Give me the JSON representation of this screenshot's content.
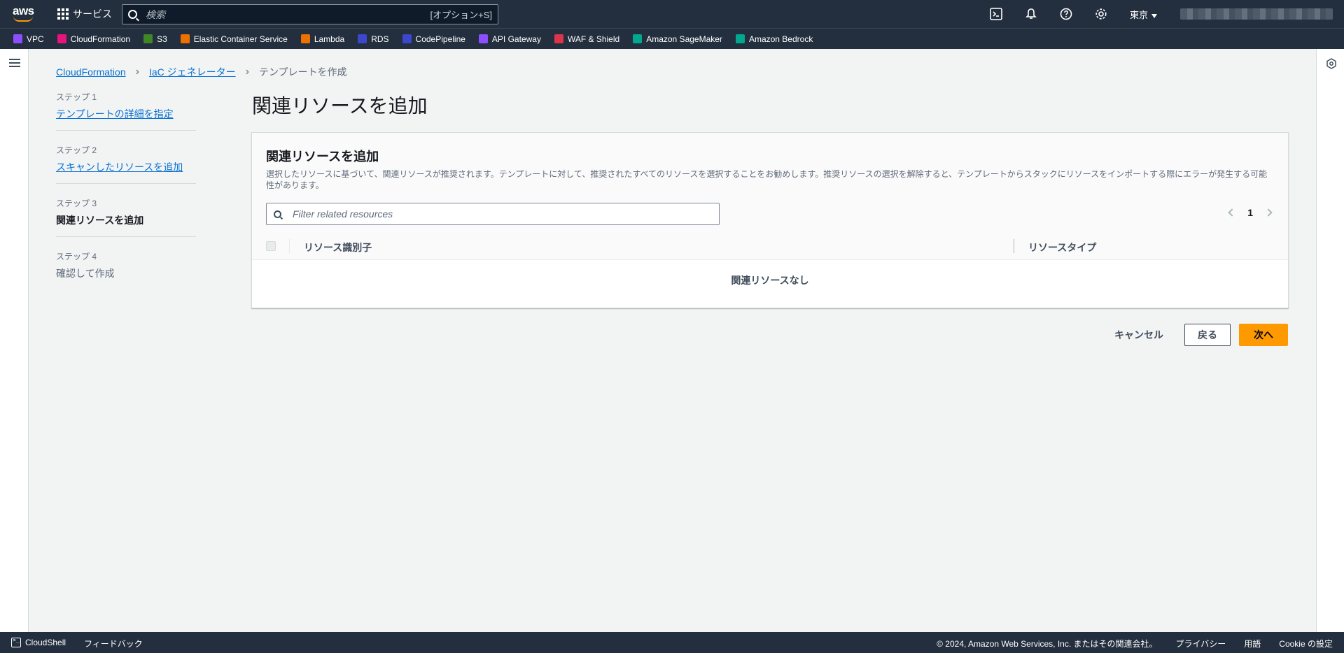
{
  "topbar": {
    "logo_text": "aws",
    "services_label": "サービス",
    "search_placeholder": "検索",
    "search_shortcut": "[オプション+S]",
    "region_label": "東京"
  },
  "favorites": [
    {
      "label": "VPC",
      "color": "#8c4fff"
    },
    {
      "label": "CloudFormation",
      "color": "#e7157b"
    },
    {
      "label": "S3",
      "color": "#3f8624"
    },
    {
      "label": "Elastic Container Service",
      "color": "#ed7100"
    },
    {
      "label": "Lambda",
      "color": "#ed7100"
    },
    {
      "label": "RDS",
      "color": "#3b48cc"
    },
    {
      "label": "CodePipeline",
      "color": "#3b48cc"
    },
    {
      "label": "API Gateway",
      "color": "#8c4fff"
    },
    {
      "label": "WAF & Shield",
      "color": "#dd344c"
    },
    {
      "label": "Amazon SageMaker",
      "color": "#01a88d"
    },
    {
      "label": "Amazon Bedrock",
      "color": "#01a88d"
    }
  ],
  "breadcrumb": {
    "items": [
      "CloudFormation",
      "IaC ジェネレーター"
    ],
    "current": "テンプレートを作成"
  },
  "steps": [
    {
      "num": "ステップ 1",
      "title": "テンプレートの詳細を指定",
      "state": "link"
    },
    {
      "num": "ステップ 2",
      "title": "スキャンしたリソースを追加",
      "state": "link"
    },
    {
      "num": "ステップ 3",
      "title": "関連リソースを追加",
      "state": "active"
    },
    {
      "num": "ステップ 4",
      "title": "確認して作成",
      "state": "disabled"
    }
  ],
  "page_title": "関連リソースを追加",
  "panel": {
    "title": "関連リソースを追加",
    "description": "選択したリソースに基づいて、関連リソースが推奨されます。テンプレートに対して、推奨されたすべてのリソースを選択することをお勧めします。推奨リソースの選択を解除すると、テンプレートからスタックにリソースをインポートする際にエラーが発生する可能性があります。",
    "filter_placeholder": "Filter related resources",
    "page_number": "1",
    "columns": [
      "リソース識別子",
      "リソースタイプ"
    ],
    "empty_text": "関連リソースなし"
  },
  "actions": {
    "cancel": "キャンセル",
    "back": "戻る",
    "next": "次へ"
  },
  "footer": {
    "cloudshell": "CloudShell",
    "feedback": "フィードバック",
    "copyright": "© 2024, Amazon Web Services, Inc. またはその関連会社。",
    "privacy": "プライバシー",
    "terms": "用語",
    "cookie": "Cookie の設定"
  },
  "colors": {
    "nav_bg": "#232f3e",
    "link": "#0972d3",
    "primary": "#ff9900"
  }
}
